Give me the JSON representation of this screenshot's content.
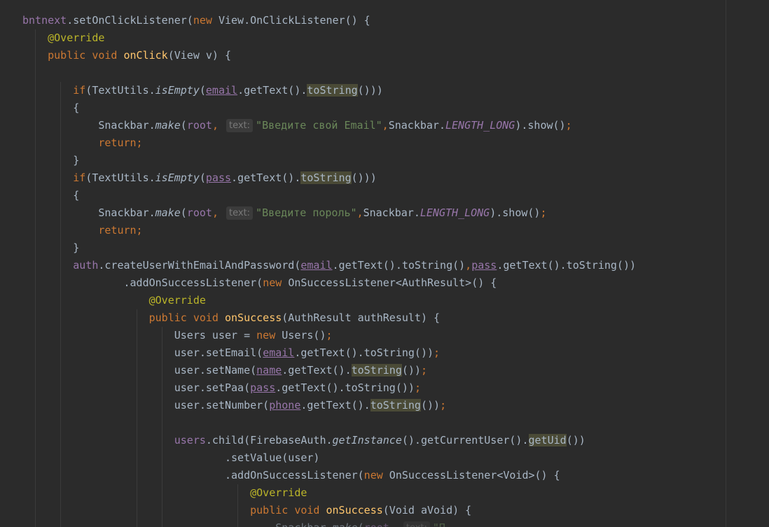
{
  "editor": {
    "language": "java",
    "theme": "darcula",
    "colors": {
      "background": "#2b2b2b",
      "default": "#a9b7c6",
      "keyword": "#cc7832",
      "annotation": "#bbb529",
      "method_declaration": "#ffc66d",
      "string": "#6a8759",
      "field": "#9876aa",
      "usage_highlight": "#4a4a36"
    },
    "lines": [
      {
        "indent": 0,
        "tokens": [
          {
            "t": "bntnext",
            "c": "fld"
          },
          {
            "t": "."
          },
          {
            "t": "setOnClickListener("
          },
          {
            "t": "new ",
            "c": "kw"
          },
          {
            "t": "View.OnClickListener() {"
          }
        ]
      },
      {
        "indent": 1,
        "tokens": [
          {
            "t": "@Override",
            "c": "ann"
          }
        ]
      },
      {
        "indent": 1,
        "tokens": [
          {
            "t": "public void ",
            "c": "kw"
          },
          {
            "t": "onClick",
            "c": "fn"
          },
          {
            "t": "(View v) {"
          }
        ]
      },
      {
        "indent": 0,
        "tokens": []
      },
      {
        "indent": 2,
        "tokens": [
          {
            "t": "if",
            "c": "kw"
          },
          {
            "t": "(TextUtils."
          },
          {
            "t": "isEmpty",
            "c": "it"
          },
          {
            "t": "("
          },
          {
            "t": "email",
            "c": "fld ul"
          },
          {
            "t": ".getText()."
          },
          {
            "t": "toString",
            "c": "hl"
          },
          {
            "t": "()))"
          }
        ]
      },
      {
        "indent": 2,
        "tokens": [
          {
            "t": "{"
          }
        ]
      },
      {
        "indent": 3,
        "tokens": [
          {
            "t": "Snackbar."
          },
          {
            "t": "make",
            "c": "it"
          },
          {
            "t": "("
          },
          {
            "t": "root",
            "c": "fld"
          },
          {
            "t": ", ",
            "c": "kw"
          },
          {
            "t": "text:",
            "c": "hint"
          },
          {
            "t": "\"Введите свой Email\"",
            "c": "str"
          },
          {
            "t": ",",
            "c": "kw"
          },
          {
            "t": "Snackbar."
          },
          {
            "t": "LENGTH_LONG",
            "c": "const"
          },
          {
            "t": ").show()"
          },
          {
            "t": ";",
            "c": "kw"
          }
        ]
      },
      {
        "indent": 3,
        "tokens": [
          {
            "t": "return;",
            "c": "kw"
          }
        ]
      },
      {
        "indent": 2,
        "tokens": [
          {
            "t": "}"
          }
        ]
      },
      {
        "indent": 2,
        "tokens": [
          {
            "t": "if",
            "c": "kw"
          },
          {
            "t": "(TextUtils."
          },
          {
            "t": "isEmpty",
            "c": "it"
          },
          {
            "t": "("
          },
          {
            "t": "pass",
            "c": "fld ul"
          },
          {
            "t": ".getText()."
          },
          {
            "t": "toString",
            "c": "hl"
          },
          {
            "t": "()))"
          }
        ]
      },
      {
        "indent": 2,
        "tokens": [
          {
            "t": "{"
          }
        ]
      },
      {
        "indent": 3,
        "tokens": [
          {
            "t": "Snackbar."
          },
          {
            "t": "make",
            "c": "it"
          },
          {
            "t": "("
          },
          {
            "t": "root",
            "c": "fld"
          },
          {
            "t": ", ",
            "c": "kw"
          },
          {
            "t": "text:",
            "c": "hint"
          },
          {
            "t": "\"Введите пороль\"",
            "c": "str"
          },
          {
            "t": ",",
            "c": "kw"
          },
          {
            "t": "Snackbar."
          },
          {
            "t": "LENGTH_LONG",
            "c": "const"
          },
          {
            "t": ").show()"
          },
          {
            "t": ";",
            "c": "kw"
          }
        ]
      },
      {
        "indent": 3,
        "tokens": [
          {
            "t": "return;",
            "c": "kw"
          }
        ]
      },
      {
        "indent": 2,
        "tokens": [
          {
            "t": "}"
          }
        ]
      },
      {
        "indent": 2,
        "tokens": [
          {
            "t": "auth",
            "c": "fld"
          },
          {
            "t": ".createUserWithEmailAndPassword("
          },
          {
            "t": "email",
            "c": "fld ul"
          },
          {
            "t": ".getText().toString()"
          },
          {
            "t": ",",
            "c": "kw"
          },
          {
            "t": "pass",
            "c": "fld ul"
          },
          {
            "t": ".getText().toString())"
          }
        ]
      },
      {
        "indent": 4,
        "tokens": [
          {
            "t": ".addOnSuccessListener("
          },
          {
            "t": "new ",
            "c": "kw"
          },
          {
            "t": "OnSuccessListener<AuthResult>() {"
          }
        ]
      },
      {
        "indent": 5,
        "tokens": [
          {
            "t": "@Override",
            "c": "ann"
          }
        ]
      },
      {
        "indent": 5,
        "tokens": [
          {
            "t": "public void ",
            "c": "kw"
          },
          {
            "t": "onSuccess",
            "c": "fn"
          },
          {
            "t": "(AuthResult authResult) {"
          }
        ]
      },
      {
        "indent": 6,
        "tokens": [
          {
            "t": "Users user = "
          },
          {
            "t": "new ",
            "c": "kw"
          },
          {
            "t": "Users()"
          },
          {
            "t": ";",
            "c": "kw"
          }
        ]
      },
      {
        "indent": 6,
        "tokens": [
          {
            "t": "user.setEmail("
          },
          {
            "t": "email",
            "c": "fld ul"
          },
          {
            "t": ".getText().toString())"
          },
          {
            "t": ";",
            "c": "kw"
          }
        ]
      },
      {
        "indent": 6,
        "tokens": [
          {
            "t": "user.setName("
          },
          {
            "t": "name",
            "c": "fld ul"
          },
          {
            "t": ".getText()."
          },
          {
            "t": "toString",
            "c": "hl"
          },
          {
            "t": "())"
          },
          {
            "t": ";",
            "c": "kw"
          }
        ]
      },
      {
        "indent": 6,
        "tokens": [
          {
            "t": "user.setPaa("
          },
          {
            "t": "pass",
            "c": "fld ul"
          },
          {
            "t": ".getText().toString())"
          },
          {
            "t": ";",
            "c": "kw"
          }
        ]
      },
      {
        "indent": 6,
        "tokens": [
          {
            "t": "user.setNumber("
          },
          {
            "t": "phone",
            "c": "fld ul"
          },
          {
            "t": ".getText()."
          },
          {
            "t": "toString",
            "c": "hl"
          },
          {
            "t": "())"
          },
          {
            "t": ";",
            "c": "kw"
          }
        ]
      },
      {
        "indent": 0,
        "tokens": []
      },
      {
        "indent": 6,
        "tokens": [
          {
            "t": "users",
            "c": "fld"
          },
          {
            "t": ".child(FirebaseAuth."
          },
          {
            "t": "getInstance",
            "c": "it"
          },
          {
            "t": "().getCurrentUser()."
          },
          {
            "t": "getUid",
            "c": "hl"
          },
          {
            "t": "())"
          }
        ]
      },
      {
        "indent": 8,
        "tokens": [
          {
            "t": ".setValue(user)"
          }
        ]
      },
      {
        "indent": 8,
        "tokens": [
          {
            "t": ".addOnSuccessListener("
          },
          {
            "t": "new ",
            "c": "kw"
          },
          {
            "t": "OnSuccessListener<Void>() {"
          }
        ]
      },
      {
        "indent": 9,
        "tokens": [
          {
            "t": "@Override",
            "c": "ann"
          }
        ]
      },
      {
        "indent": 9,
        "tokens": [
          {
            "t": "public void ",
            "c": "kw"
          },
          {
            "t": "onSuccess",
            "c": "fn"
          },
          {
            "t": "(Void aVoid) {"
          }
        ]
      },
      {
        "indent": 10,
        "cut": true,
        "tokens": [
          {
            "t": "Snackbar."
          },
          {
            "t": "make",
            "c": "it"
          },
          {
            "t": "("
          },
          {
            "t": "root",
            "c": "fld"
          },
          {
            "t": ", ",
            "c": "kw"
          },
          {
            "t": "text:",
            "c": "hint"
          },
          {
            "t": "\"П",
            "c": "str"
          }
        ]
      }
    ]
  }
}
